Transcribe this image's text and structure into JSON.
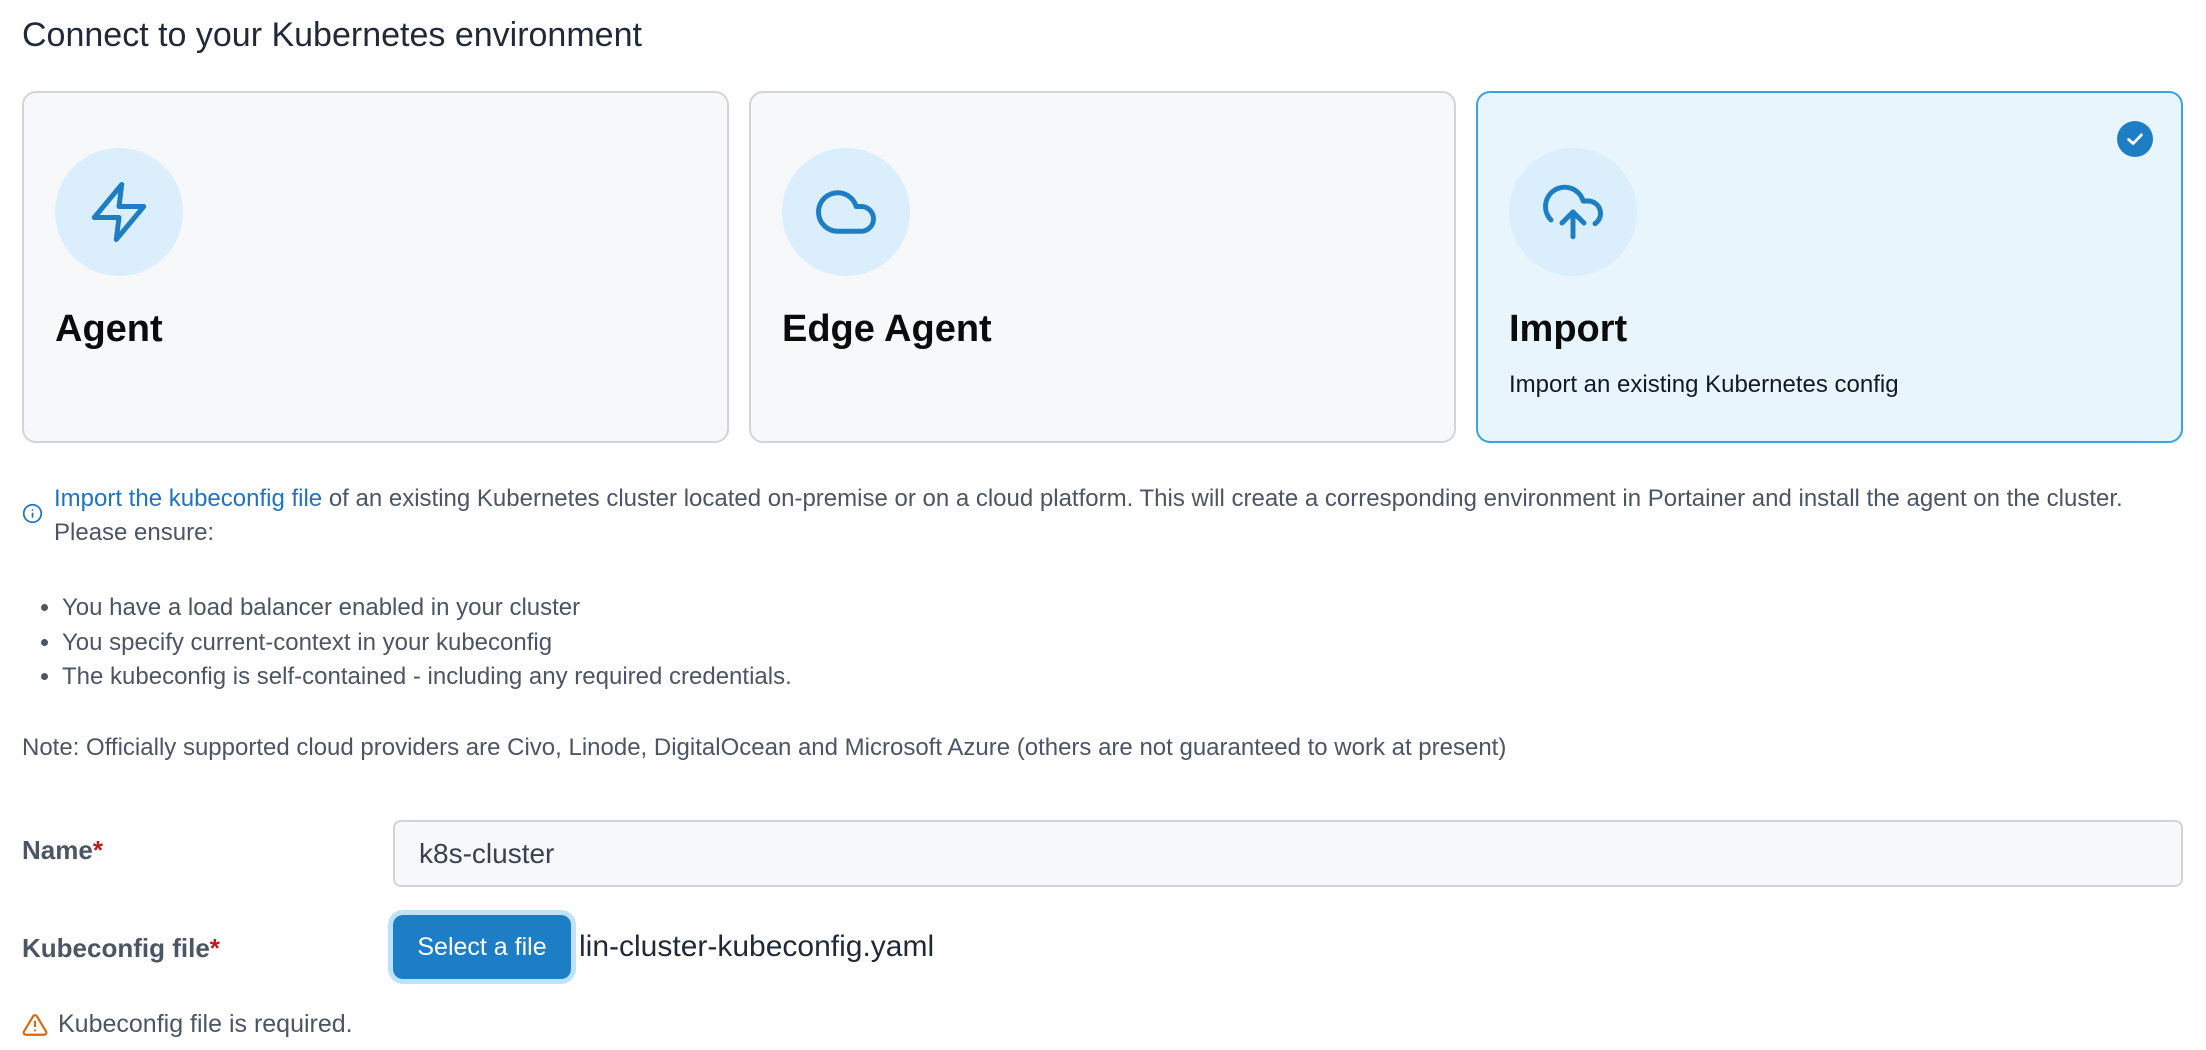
{
  "heading": "Connect to your Kubernetes environment",
  "cards": [
    {
      "title": "Agent",
      "description": "",
      "icon": "lightning-icon",
      "selected": false
    },
    {
      "title": "Edge Agent",
      "description": "",
      "icon": "cloud-icon",
      "selected": false
    },
    {
      "title": "Import",
      "description": "Import an existing Kubernetes config",
      "icon": "cloud-upload-icon",
      "selected": true
    }
  ],
  "info": {
    "icon": "info-circle-icon",
    "link_text": "Import the kubeconfig file",
    "text": " of an existing Kubernetes cluster located on-premise or on a cloud platform. This will create a corresponding environment in Portainer and install the agent on the cluster. Please ensure:"
  },
  "requirements": [
    "You have a load balancer enabled in your cluster",
    "You specify current-context in your kubeconfig",
    "The kubeconfig is self-contained - including any required credentials."
  ],
  "note": "Note: Officially supported cloud providers are Civo, Linode, DigitalOcean and Microsoft Azure (others are not guaranteed to work at present)",
  "form": {
    "name_label": "Name",
    "name_value": "k8s-cluster",
    "kubeconfig_label": "Kubeconfig file",
    "required_marker": "*",
    "select_file_label": "Select a file",
    "file_name": "lin-cluster-kubeconfig.yaml",
    "error_text": "Kubeconfig file is required."
  },
  "colors": {
    "accent": "#1d7ec5",
    "selected_border": "#3aa3e0",
    "selected_bg": "#e9f5fd",
    "link": "#1f73c1",
    "required": "#b91c1c",
    "warning": "#d9670b"
  }
}
